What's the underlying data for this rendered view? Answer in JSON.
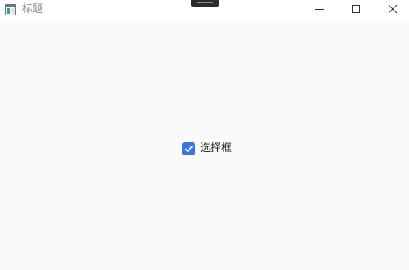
{
  "window": {
    "title": "标题"
  },
  "checkbox": {
    "label": "选择框",
    "checked": true,
    "accent_color": "#3b74e8"
  },
  "icons": {
    "app": "app-window-icon",
    "minimize": "minimize-icon",
    "maximize": "maximize-icon",
    "close": "close-icon",
    "check": "checkmark-icon"
  }
}
